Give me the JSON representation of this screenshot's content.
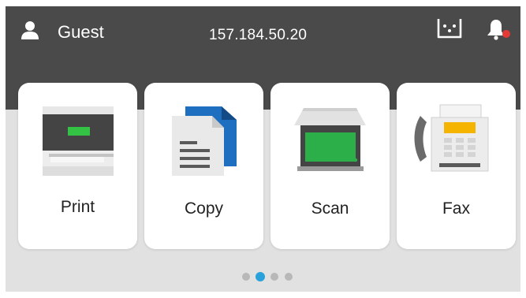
{
  "header": {
    "user_label": "Guest",
    "ip_address": "157.184.50.20",
    "notification_dot_color": "#e53935"
  },
  "tiles": [
    {
      "label": "Print",
      "icon": "printer-icon"
    },
    {
      "label": "Copy",
      "icon": "copy-icon"
    },
    {
      "label": "Scan",
      "icon": "scanner-icon"
    },
    {
      "label": "Fax",
      "icon": "fax-icon"
    }
  ],
  "pager": {
    "total_pages": 4,
    "active_page": 2
  },
  "colors": {
    "header_bg": "#4a4a4a",
    "content_bg": "#e1e1e1",
    "accent_green": "#2fb24a",
    "accent_blue": "#29a2dc"
  }
}
